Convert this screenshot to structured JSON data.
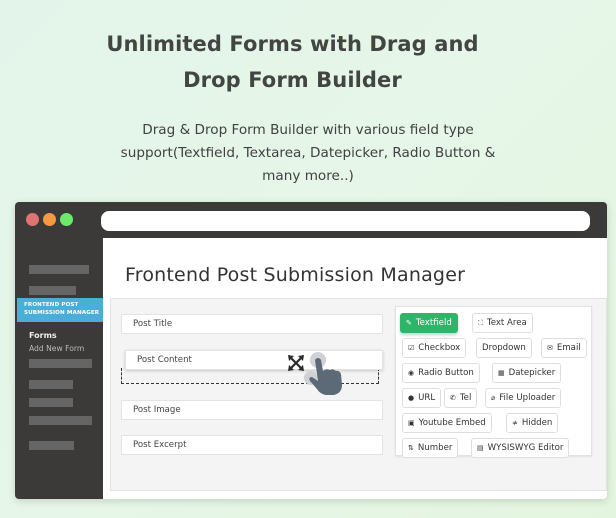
{
  "headline": {
    "line1": "Unlimited Forms with Drag and",
    "line2": "Drop Form Builder"
  },
  "subtitle": {
    "line1": "Drag & Drop Form Builder with various field type",
    "line2": "support(Textfield, Textarea, Datepicker, Radio Button &",
    "line3": "many more..)"
  },
  "window": {
    "url": "",
    "sidebar": {
      "active_item": "FRONTEND POST SUBMISSION MANAGER",
      "active_line1": "FRONTEND POST",
      "active_line2": "SUBMISSION MANAGER",
      "submenu": [
        "Forms",
        "Add New Form"
      ]
    },
    "main": {
      "title": "Frontend Post Submission Manager",
      "form_fields": [
        "Post Title",
        "Post Content",
        "Post Image",
        "Post Excerpt"
      ],
      "dragging_field": "Post Content",
      "palette": [
        {
          "label": "Textfield",
          "icon": "edit-icon",
          "glyph": "✎",
          "active": true
        },
        {
          "label": "Text Area",
          "icon": "expand-icon",
          "glyph": "⛶",
          "active": false
        },
        {
          "label": "Checkbox",
          "icon": "checkbox-icon",
          "glyph": "☑",
          "active": false
        },
        {
          "label": "Dropdown",
          "icon": "",
          "glyph": "",
          "active": false
        },
        {
          "label": "Email",
          "icon": "envelope-icon",
          "glyph": "✉",
          "active": false
        },
        {
          "label": "Radio Button",
          "icon": "radio-icon",
          "glyph": "◉",
          "active": false
        },
        {
          "label": "Datepicker",
          "icon": "calendar-icon",
          "glyph": "▦",
          "active": false
        },
        {
          "label": "URL",
          "icon": "globe-icon",
          "glyph": "●",
          "active": false
        },
        {
          "label": "Tel",
          "icon": "phone-icon",
          "glyph": "✆",
          "active": false
        },
        {
          "label": "File Uploader",
          "icon": "paperclip-icon",
          "glyph": "⌀",
          "active": false
        },
        {
          "label": "Youtube Embed",
          "icon": "video-icon",
          "glyph": "▣",
          "active": false
        },
        {
          "label": "Hidden",
          "icon": "eye-slash-icon",
          "glyph": "≉",
          "active": false
        },
        {
          "label": "Number",
          "icon": "sort-numeric-icon",
          "glyph": "⇅",
          "active": false
        },
        {
          "label": "WYSISWYG Editor",
          "icon": "editor-icon",
          "glyph": "▤",
          "active": false
        }
      ]
    }
  },
  "colors": {
    "accent_green": "#2fb56a",
    "sidebar_active": "#4aaed8",
    "chrome_dark": "#3b3a38"
  }
}
